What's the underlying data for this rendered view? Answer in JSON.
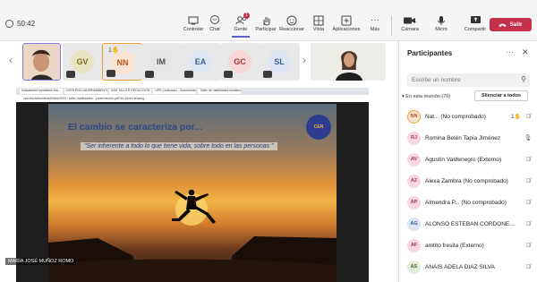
{
  "timer": "50:42",
  "toolbar": {
    "items": [
      {
        "label": "Controlar",
        "icon": "cast-icon"
      },
      {
        "label": "Chat",
        "icon": "chat-icon"
      },
      {
        "label": "Gente",
        "icon": "people-icon",
        "badge": "1"
      },
      {
        "label": "Participar",
        "icon": "raise-hand-icon"
      },
      {
        "label": "Reaccionar",
        "icon": "smiley-icon"
      },
      {
        "label": "Vista",
        "icon": "grid-view-icon"
      },
      {
        "label": "Aplicaciones",
        "icon": "add-apps-icon"
      },
      {
        "label": "Más",
        "icon": "more-icon"
      }
    ],
    "camera_label": "Cámara",
    "mic_label": "Micro",
    "share_label": "Compartir",
    "leave_label": "Salir"
  },
  "stage": {
    "tiles": [
      {
        "initials": "GV",
        "bg": "#e8e4c2",
        "fg": "#7a6a1c"
      },
      {
        "initials": "NN",
        "bg": "#fae3d1",
        "fg": "#b3541e",
        "hand_count": "1",
        "active": true
      },
      {
        "initials": "IM",
        "bg": "#e6e6e6",
        "fg": "#555555"
      },
      {
        "initials": "EA",
        "bg": "#dde7f3",
        "fg": "#3a5f91"
      },
      {
        "initials": "GC",
        "bg": "#f7d6d6",
        "fg": "#a33a3a"
      },
      {
        "initials": "SL",
        "bg": "#dde5f4",
        "fg": "#3a5f91"
      }
    ],
    "browser_tabs": [
      "Indicadores sumativos ma...",
      "LISTA ENCUADERNAMIENTO",
      "2023 TALLER REDUCCIÓN",
      "UPS | Indicador - Documentos",
      "Taller de habilidades sociales"
    ],
    "url": "ups.edu/sites/default/files/2023 - taller-habilidades - presentación.pdf?id=1&ref=sharing",
    "slide_title": "El cambio se caracteriza por...",
    "slide_quote": "\"Ser inherente a todo lo que tiene vida, sobre todo en las personas \"",
    "slide_logo": "CEN",
    "presenter": "MARÍA JOSÉ MUÑOZ ROMO"
  },
  "panel": {
    "title": "Participantes",
    "search_placeholder": "Escribe un nombre",
    "section_label": "En esta reunión (76)",
    "mute_all_label": "Silenciar a todos",
    "participants": [
      {
        "initials": "NN",
        "name": "Nat... (No comprobado)",
        "bg": "#fae3d1",
        "fg": "#b3541e",
        "hand": "1",
        "mic": "muted"
      },
      {
        "initials": "RJ",
        "name": "Romina Belén Tapia Jiménez",
        "bg": "#f7d6e0",
        "fg": "#a33a5c",
        "mic": "on"
      },
      {
        "initials": "AV",
        "name": "Agustín Valdenegro (Externo)",
        "bg": "#f7d6e0",
        "fg": "#a33a5c",
        "mic": "muted"
      },
      {
        "initials": "AZ",
        "name": "Alexa Zambra (No comprobado)",
        "bg": "#f7d6e0",
        "fg": "#a33a5c",
        "mic": "muted"
      },
      {
        "initials": "AP",
        "name": "Almendra P... (No comprobado)",
        "bg": "#f7d6e0",
        "fg": "#a33a5c",
        "mic": "muted"
      },
      {
        "initials": "AG",
        "name": "ALONSO ESTEBAN CORDONE...",
        "bg": "#dde5f4",
        "fg": "#3a5f91",
        "mic": "muted"
      },
      {
        "initials": "AF",
        "name": "amtito fresita (Externo)",
        "bg": "#f7d6e0",
        "fg": "#a33a5c",
        "mic": "muted"
      },
      {
        "initials": "AS",
        "name": "ANAÍS ADELA DIAZ SILVA",
        "bg": "#e2ecd9",
        "fg": "#4a6b2a",
        "mic": "muted"
      }
    ]
  },
  "colors": {
    "accent": "#5b5fc7",
    "leave": "#c4314b",
    "raised_hand": "#e8a23a"
  }
}
